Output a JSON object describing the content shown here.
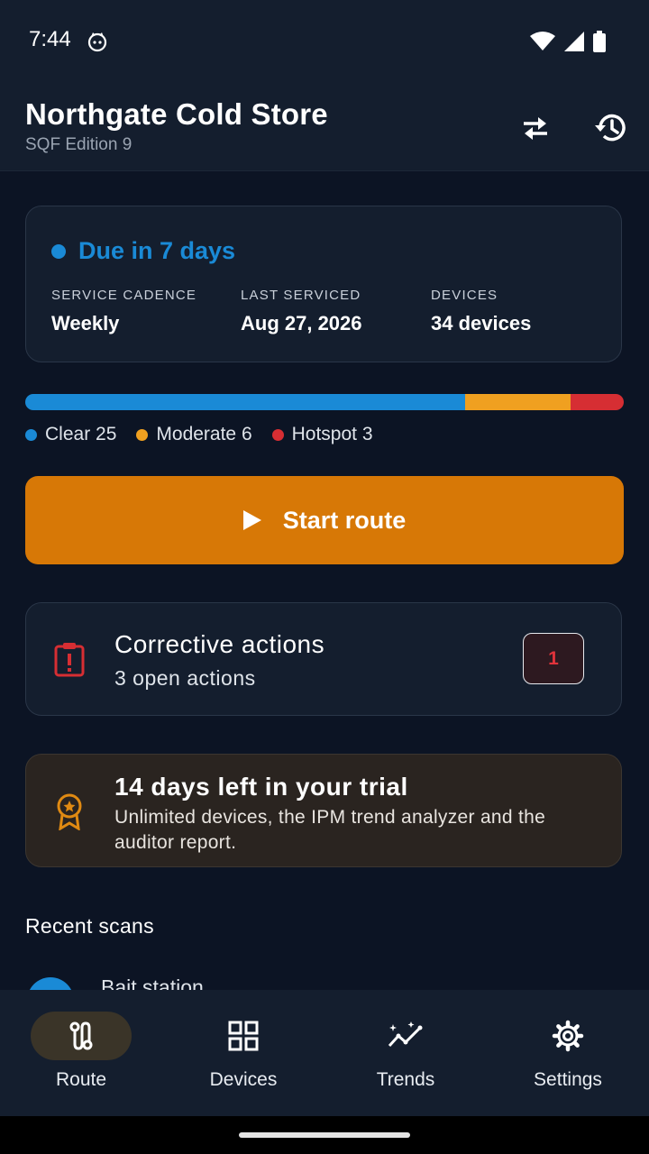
{
  "status_bar": {
    "time": "7:44"
  },
  "header": {
    "title": "Northgate Cold Store",
    "subtitle": "SQF Edition 9"
  },
  "due_card": {
    "status": "Due in 7 days",
    "status_color": "#1a8ad6",
    "stats": [
      {
        "label": "SERVICE CADENCE",
        "value": "Weekly"
      },
      {
        "label": "LAST SERVICED",
        "value": "Aug 27, 2026"
      },
      {
        "label": "DEVICES",
        "value": "34 devices"
      }
    ]
  },
  "distribution": {
    "total": 34,
    "segments": [
      {
        "label": "Clear 25",
        "count": 25,
        "color": "#1a8ad6"
      },
      {
        "label": "Moderate 6",
        "count": 6,
        "color": "#f0a020"
      },
      {
        "label": "Hotspot 3",
        "count": 3,
        "color": "#d62e33"
      }
    ]
  },
  "start_button": {
    "label": "Start route",
    "color": "#d77806"
  },
  "corrective_actions": {
    "title": "Corrective actions",
    "subtitle": "3 open actions",
    "badge": "1",
    "icon": "clipboard-alert-icon"
  },
  "trial": {
    "title": "14 days left in your trial",
    "body": "Unlimited devices, the IPM trend analyzer and the auditor report.",
    "icon": "award-badge-icon"
  },
  "recent_scans": {
    "title": "Recent scans",
    "items": [
      {
        "name": "Bait station"
      }
    ]
  },
  "bottom_nav": {
    "items": [
      {
        "label": "Route",
        "icon": "route-icon",
        "active": true
      },
      {
        "label": "Devices",
        "icon": "grid-icon",
        "active": false
      },
      {
        "label": "Trends",
        "icon": "trends-icon",
        "active": false
      },
      {
        "label": "Settings",
        "icon": "gear-icon",
        "active": false
      }
    ]
  }
}
